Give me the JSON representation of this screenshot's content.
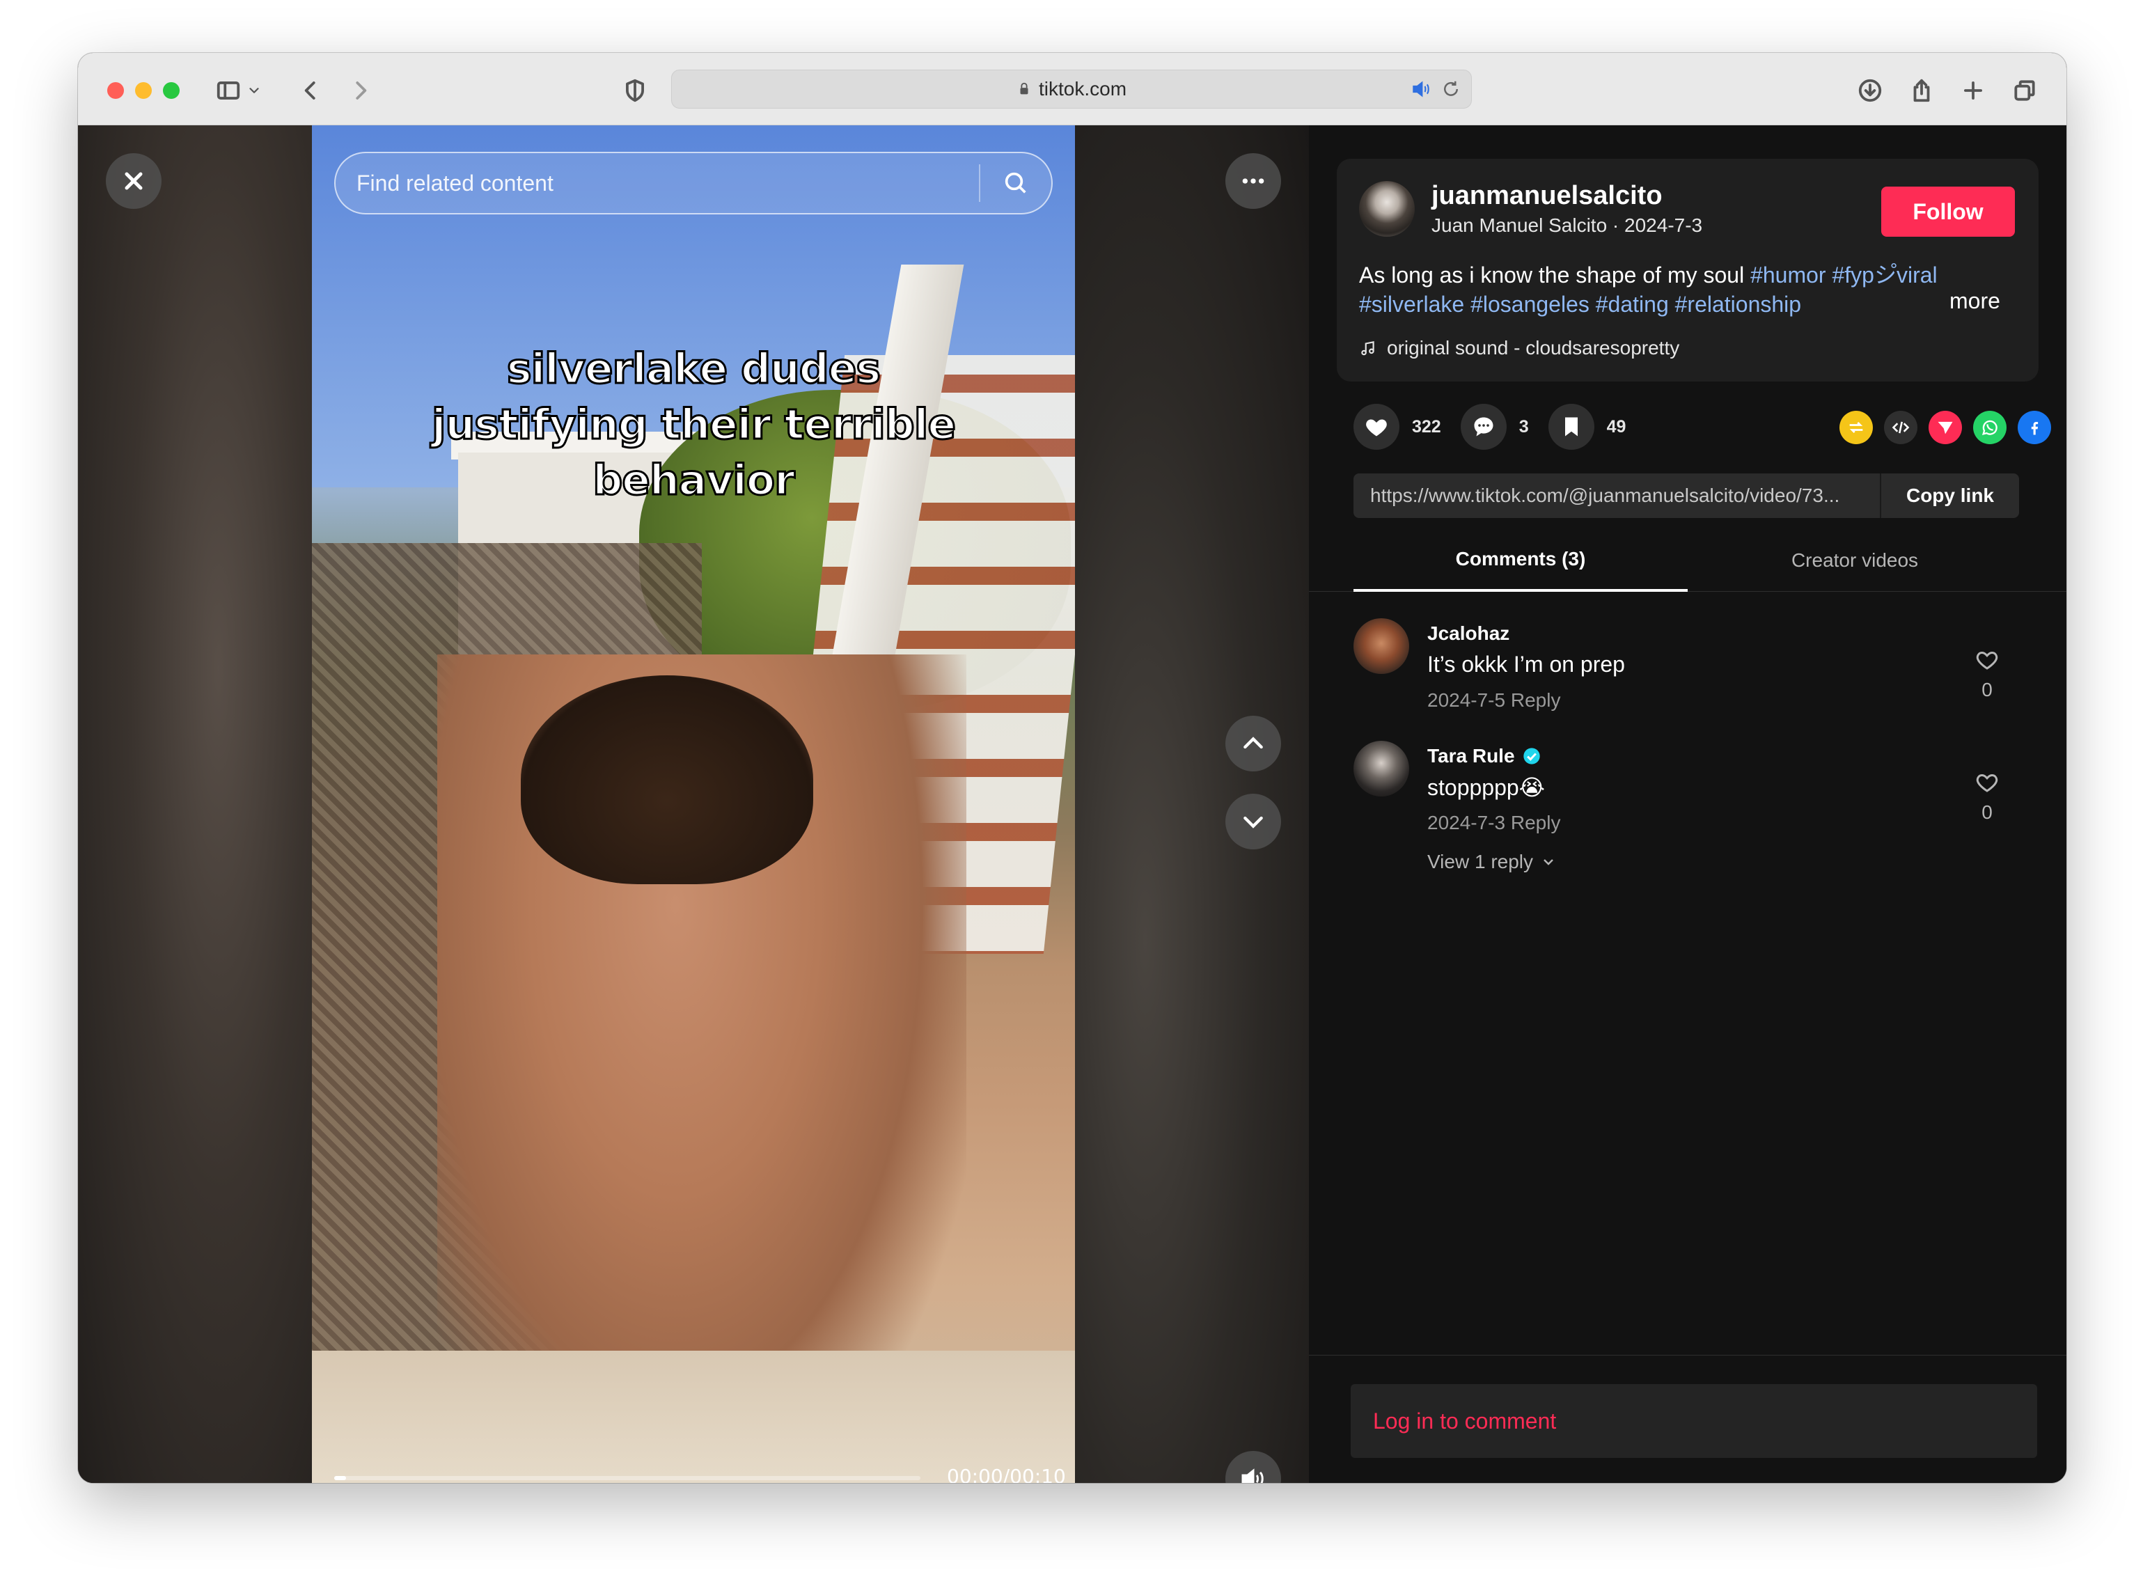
{
  "browser": {
    "url": "tiktok.com",
    "controls": {
      "close_color": "#ff5f57",
      "min_color": "#febc2e",
      "max_color": "#28c840"
    }
  },
  "video": {
    "search_placeholder": "Find related content",
    "overlay_text_lines": [
      "silverlake dudes",
      "justifying their terrible",
      "behavior"
    ],
    "time": "00:00/00:10",
    "progress_fraction": 0.02
  },
  "post": {
    "username": "juanmanuelsalcito",
    "display_line": "Juan Manuel Salcito · 2024-7-3",
    "follow_label": "Follow",
    "description_text": "As long as i know the shape of my soul ",
    "hashtags_line1": "#humor #fypシ゚viral",
    "hashtags_line2": "#silverlake #losangeles #dating #relationship",
    "more_label": "more",
    "music": "original sound - cloudsaresopretty",
    "likes": "322",
    "comments": "3",
    "saves": "49",
    "link": "https://www.tiktok.com/@juanmanuelsalcito/video/73...",
    "copy_label": "Copy link"
  },
  "tabs": {
    "comments": "Comments (3)",
    "creator": "Creator videos"
  },
  "comments": [
    {
      "name": "Jcalohaz",
      "text": "It’s okkk I’m on prep",
      "meta": "2024-7-5 Reply",
      "likes": "0"
    },
    {
      "name": "Tara Rule",
      "text": "stoppppp😭",
      "meta": "2024-7-3 Reply",
      "likes": "0",
      "view_replies": "View 1 reply"
    }
  ],
  "login_label": "Log in to comment",
  "colors": {
    "accent": "#fe2c55",
    "hashtag": "#8fb8f2",
    "panel_bg": "#121212"
  }
}
